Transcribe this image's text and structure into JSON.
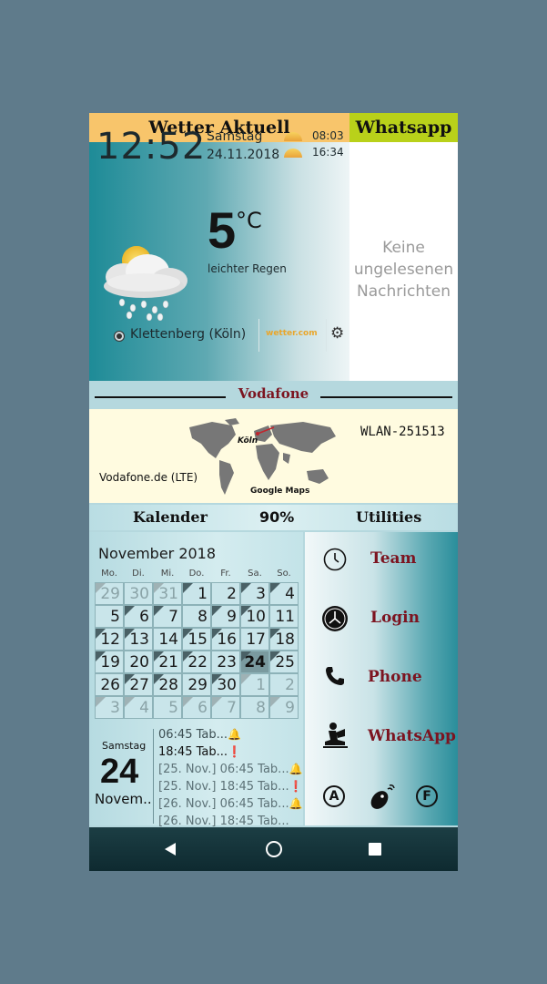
{
  "header": {
    "weather_title": "Wetter Aktuell",
    "whatsapp_title": "Whatsapp"
  },
  "weather": {
    "time": "12:52",
    "weekday": "Samstag",
    "date": "24.11.2018",
    "sunrise": "08:03",
    "sunset": "16:34",
    "temperature": "5",
    "unit": "°C",
    "condition": "leichter Regen",
    "location": "Klettenberg (Köln)",
    "provider": "wetter.com",
    "icon": "rain-cloud-sun-icon"
  },
  "whatsapp": {
    "message": "Keine ungelesenen Nachrichten"
  },
  "network": {
    "carrier_title": "Vodafone",
    "wlan": "WLAN-251513",
    "network_label": "Vodafone.de (LTE)",
    "map_label": "Google Maps",
    "map_city": "Köln"
  },
  "sections": {
    "calendar": "Kalender",
    "battery": "90%",
    "utilities": "Utilities"
  },
  "calendar": {
    "month": "November 2018",
    "weekdays": [
      "Mo.",
      "Di.",
      "Mi.",
      "Do.",
      "Fr.",
      "Sa.",
      "So."
    ],
    "weeks": [
      [
        "29",
        "30",
        "31",
        "1",
        "2",
        "3",
        "4"
      ],
      [
        "5",
        "6",
        "7",
        "8",
        "9",
        "10",
        "11"
      ],
      [
        "12",
        "13",
        "14",
        "15",
        "16",
        "17",
        "18"
      ],
      [
        "19",
        "20",
        "21",
        "22",
        "23",
        "24",
        "25"
      ],
      [
        "26",
        "27",
        "28",
        "29",
        "30",
        "1",
        "2"
      ],
      [
        "3",
        "4",
        "5",
        "6",
        "7",
        "8",
        "9"
      ]
    ],
    "today_weekday": "Samstag",
    "today_day": "24",
    "today_month": "Novem..",
    "events": [
      {
        "text": "06:45 Tab...",
        "bell": "🔔"
      },
      {
        "text": "18:45 Tab...",
        "bell": "❗"
      },
      {
        "text": "[25. Nov.] 06:45 Tab...",
        "bell": "🔔"
      },
      {
        "text": "[25. Nov.] 18:45 Tab...",
        "bell": "❗"
      },
      {
        "text": "[26. Nov.] 06:45 Tab...",
        "bell": "🔔"
      },
      {
        "text": "[26. Nov.] 18:45 Tab...",
        "bell": ""
      }
    ]
  },
  "utilities": {
    "items": [
      {
        "label": "Team",
        "icon": "clock-outline-icon"
      },
      {
        "label": "Login",
        "icon": "clock-filled-icon"
      },
      {
        "label": "Phone",
        "icon": "phone-icon"
      },
      {
        "label": "WhatsApp",
        "icon": "reading-person-icon"
      }
    ],
    "bottom_icons": [
      {
        "text": "A",
        "icon": "a-circle-icon"
      },
      {
        "text": "",
        "icon": "mouse-icon"
      },
      {
        "text": "F",
        "icon": "f-circle-icon"
      }
    ]
  },
  "colors": {
    "accent_red": "#7c1420",
    "header_orange": "#f8c56b",
    "header_green": "#b9d11a",
    "teal": "#2a8e9b"
  }
}
